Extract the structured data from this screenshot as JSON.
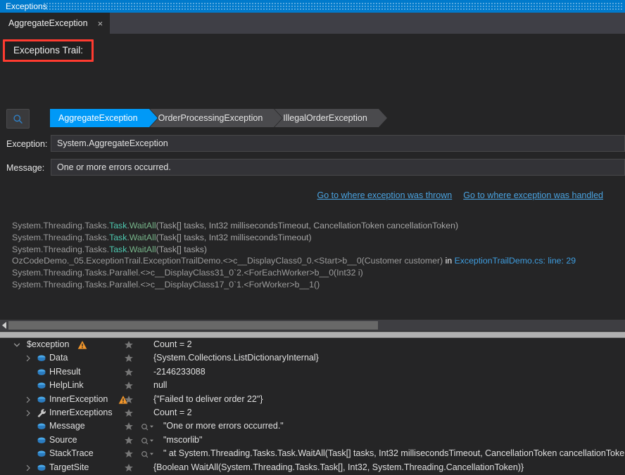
{
  "window": {
    "title": "Exceptions"
  },
  "doc_tab": {
    "label": "AggregateException",
    "close": "×"
  },
  "annotation": {
    "trail_label": "Exceptions Trail:"
  },
  "toolbar": {
    "search_icon": "magnifier-icon"
  },
  "breadcrumb": {
    "items": [
      {
        "label": "AggregateException",
        "active": true
      },
      {
        "label": "OrderProcessingException",
        "active": false
      },
      {
        "label": "IllegalOrderException",
        "active": false
      }
    ]
  },
  "fields": {
    "exception_label": "Exception:",
    "exception_value": "System.AggregateException",
    "message_label": "Message:",
    "message_value": "One or more errors occurred."
  },
  "links": {
    "thrown": "Go to where exception was thrown",
    "handled": "Go to where exception was handled"
  },
  "stack_trace": {
    "lines": [
      [
        {
          "t": "System.Threading.Tasks.",
          "c": "ns"
        },
        {
          "t": "Task",
          "c": "typ"
        },
        {
          "t": ".",
          "c": "ns"
        },
        {
          "t": "WaitAll",
          "c": "mth"
        },
        {
          "t": "(Task[] tasks, Int32 millisecondsTimeout, CancellationToken cancellationToken)",
          "c": "prm"
        }
      ],
      [
        {
          "t": "System.Threading.Tasks.",
          "c": "ns"
        },
        {
          "t": "Task",
          "c": "typ"
        },
        {
          "t": ".",
          "c": "ns"
        },
        {
          "t": "WaitAll",
          "c": "mth"
        },
        {
          "t": "(Task[] tasks, Int32 millisecondsTimeout)",
          "c": "prm"
        }
      ],
      [
        {
          "t": "System.Threading.Tasks.",
          "c": "ns"
        },
        {
          "t": "Task",
          "c": "typ"
        },
        {
          "t": ".",
          "c": "ns"
        },
        {
          "t": "WaitAll",
          "c": "mth"
        },
        {
          "t": "(Task[] tasks)",
          "c": "prm"
        }
      ],
      [
        {
          "t": "OzCodeDemo._05.ExceptionTrail.ExceptionTrailDemo.<>c__DisplayClass0_0.<Start>b__0(Customer customer)",
          "c": "ns"
        },
        {
          "t": " in ",
          "c": "kw"
        },
        {
          "t": "ExceptionTrailDemo.cs: line: 29",
          "c": "file"
        }
      ],
      [
        {
          "t": "System.Threading.Tasks.Parallel.<>c__DisplayClass31_0`2.<ForEachWorker>b__0(Int32 i)",
          "c": "ns"
        }
      ],
      [
        {
          "t": "System.Threading.Tasks.Parallel.<>c__DisplayClass17_0`1.<ForWorker>b__1()",
          "c": "ns"
        }
      ]
    ]
  },
  "watch_grid": {
    "rows": [
      {
        "name": "$exception",
        "depth": 0,
        "expander": "expanded",
        "icon": "none",
        "warn": true,
        "star": true,
        "mag": false,
        "value": "Count = 2"
      },
      {
        "name": "Data",
        "depth": 1,
        "expander": "collapsed",
        "icon": "property",
        "warn": false,
        "star": true,
        "mag": false,
        "value": "{System.Collections.ListDictionaryInternal}"
      },
      {
        "name": "HResult",
        "depth": 1,
        "expander": "none",
        "icon": "property",
        "warn": false,
        "star": true,
        "mag": false,
        "value": "-2146233088"
      },
      {
        "name": "HelpLink",
        "depth": 1,
        "expander": "none",
        "icon": "property",
        "warn": false,
        "star": true,
        "mag": false,
        "value": "null"
      },
      {
        "name": "InnerException",
        "depth": 1,
        "expander": "collapsed",
        "icon": "property",
        "warn": true,
        "star": true,
        "mag": false,
        "value": "{\"Failed to deliver order 22\"}"
      },
      {
        "name": "InnerExceptions",
        "depth": 1,
        "expander": "collapsed",
        "icon": "wrench",
        "warn": false,
        "star": true,
        "mag": false,
        "value": "Count = 2"
      },
      {
        "name": "Message",
        "depth": 1,
        "expander": "none",
        "icon": "property",
        "warn": false,
        "star": true,
        "mag": true,
        "value": "\"One or more errors occurred.\""
      },
      {
        "name": "Source",
        "depth": 1,
        "expander": "none",
        "icon": "property",
        "warn": false,
        "star": true,
        "mag": true,
        "value": "\"mscorlib\""
      },
      {
        "name": "StackTrace",
        "depth": 1,
        "expander": "none",
        "icon": "property",
        "warn": false,
        "star": true,
        "mag": true,
        "value": "\"   at System.Threading.Tasks.Task.WaitAll(Task[] tasks, Int32 millisecondsTimeout, CancellationToken cancellationToken)\\r\\n"
      },
      {
        "name": "TargetSite",
        "depth": 1,
        "expander": "collapsed",
        "icon": "property",
        "warn": false,
        "star": true,
        "mag": false,
        "value": "{Boolean WaitAll(System.Threading.Tasks.Task[], Int32, System.Threading.CancellationToken)}"
      }
    ]
  },
  "colors": {
    "accent_blue": "#007acc",
    "crumb_active": "#0099f7",
    "link": "#4aa3e0",
    "warning_orange": "#f29a2e",
    "annotation_red": "#ff3b30",
    "type_teal": "#4ec9b0",
    "method_green": "#77b58a"
  }
}
